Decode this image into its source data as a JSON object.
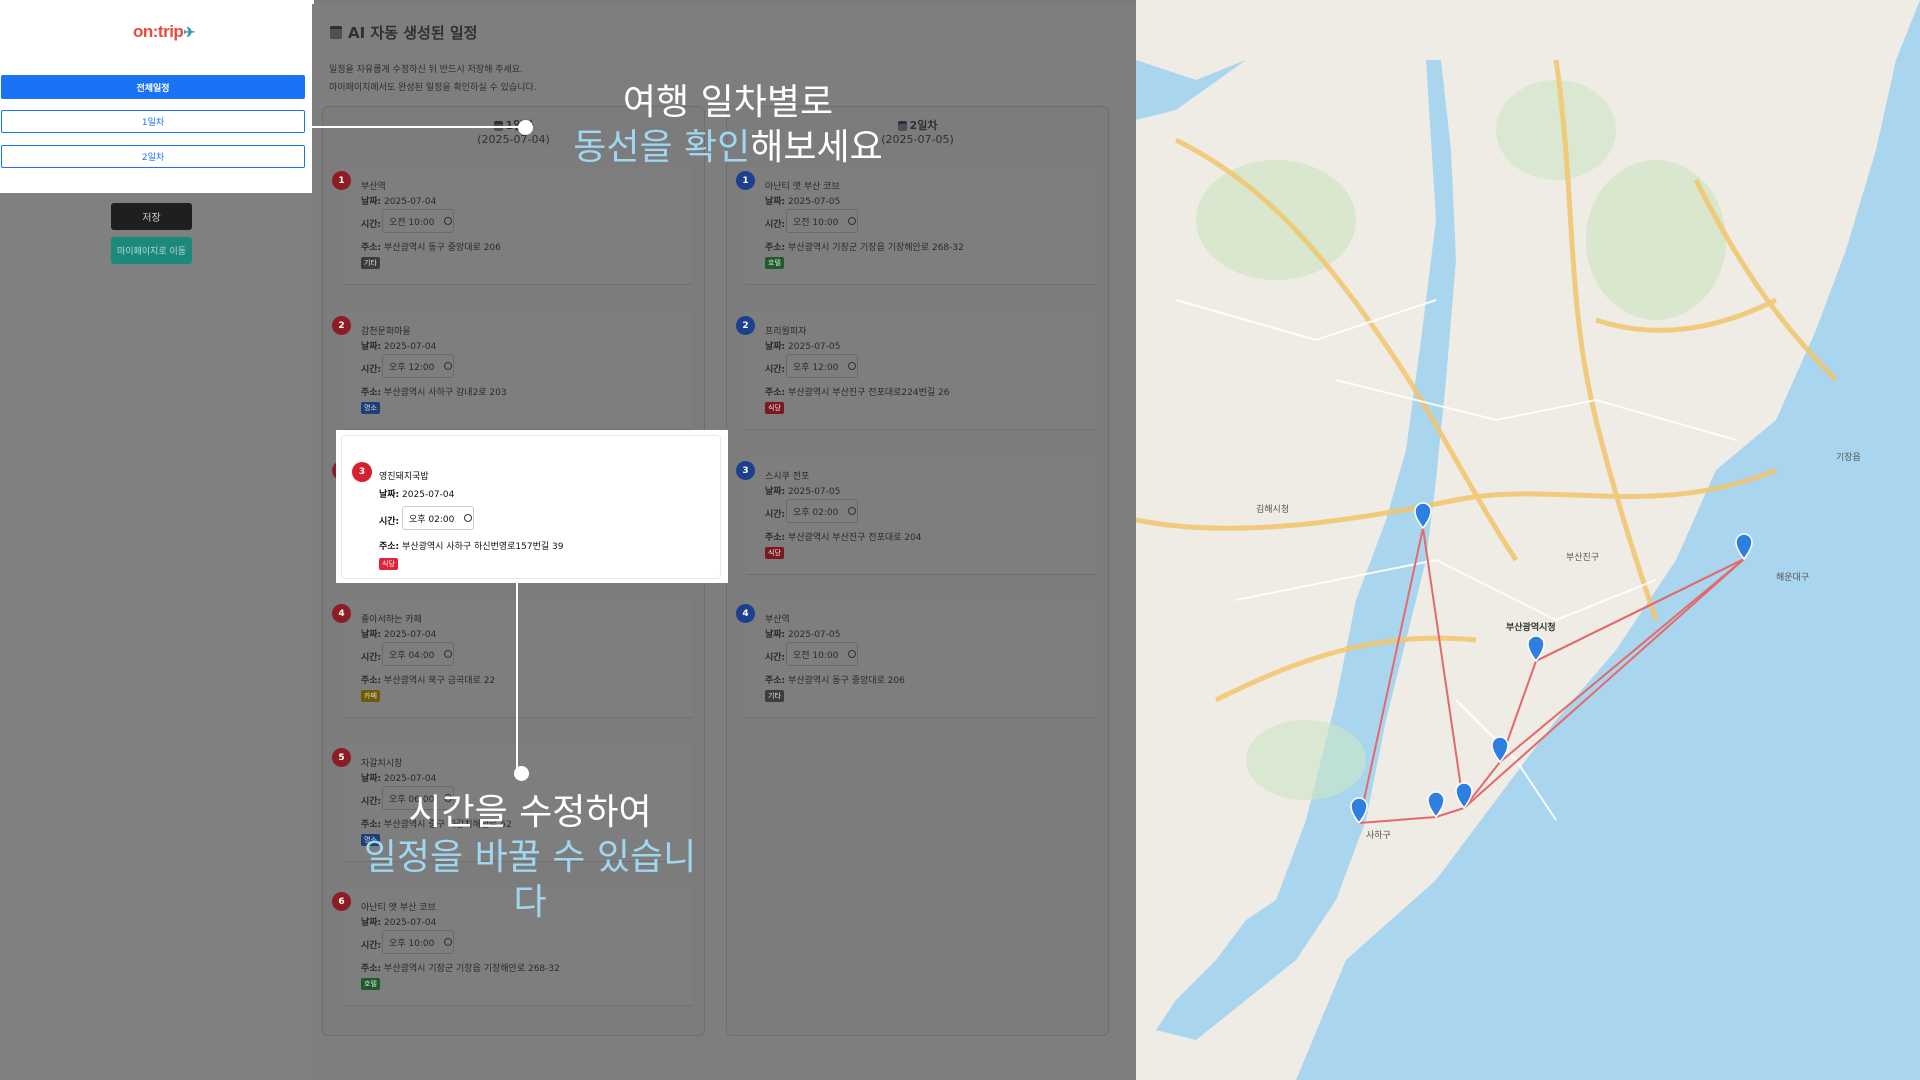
{
  "sidebar": {
    "logo_main": "on:trip",
    "buttons": {
      "all": "전체일정",
      "day1": "1일차",
      "day2": "2일차",
      "save": "저장",
      "mypage": "마이페이지로 이동"
    }
  },
  "main": {
    "title": "AI 자동 생성된 일정",
    "desc1": "일정을 자유롭게 수정하신 뒤 반드시 저장해 주세요.",
    "desc2": "마이페이지에서도 완성된 일정을 확인하실 수 있습니다.",
    "labels": {
      "date": "날짜:",
      "time": "시간:",
      "addr": "주소:"
    },
    "days": [
      {
        "title": "1일차",
        "date": "(2025-07-04)",
        "items": [
          {
            "num": "1",
            "name": "부산역",
            "date": "2025-07-04",
            "time": "오전 10:00",
            "addr": "부산광역시 동구 중앙대로 206",
            "tag": "기타"
          },
          {
            "num": "2",
            "name": "감천문화마을",
            "date": "2025-07-04",
            "time": "오후 12:00",
            "addr": "부산광역시 사하구 감내2로 203",
            "tag": "명소"
          },
          {
            "num": "3",
            "name": "영진돼지국밥",
            "date": "2025-07-04",
            "time": "오후 02:00",
            "addr": "부산광역시 사하구 하신번영로157번길 39",
            "tag": "식당"
          },
          {
            "num": "4",
            "name": "좋아서하는 카페",
            "date": "2025-07-04",
            "time": "오후 04:00",
            "addr": "부산광역시 북구 금곡대로 22",
            "tag": "카페"
          },
          {
            "num": "5",
            "name": "자갈치시장",
            "date": "2025-07-04",
            "time": "오후 06:00",
            "addr": "부산광역시 중구 자갈치해안로 52",
            "tag": "명소"
          },
          {
            "num": "6",
            "name": "아난티 앳 부산 코브",
            "date": "2025-07-04",
            "time": "오후 10:00",
            "addr": "부산광역시 기장군 기장읍 기장해안로 268-32",
            "tag": "호텔"
          }
        ]
      },
      {
        "title": "2일차",
        "date": "(2025-07-05)",
        "items": [
          {
            "num": "1",
            "name": "아난티 앳 부산 코브",
            "date": "2025-07-05",
            "time": "오전 10:00",
            "addr": "부산광역시 기장군 기장읍 기장해안로 268-32",
            "tag": "호텔"
          },
          {
            "num": "2",
            "name": "프리월피자",
            "date": "2025-07-05",
            "time": "오후 12:00",
            "addr": "부산광역시 부산진구 전포대로224번길 26",
            "tag": "식당"
          },
          {
            "num": "3",
            "name": "스시쿠 전포",
            "date": "2025-07-05",
            "time": "오후 02:00",
            "addr": "부산광역시 부산진구 전포대로 204",
            "tag": "식당"
          },
          {
            "num": "4",
            "name": "부산역",
            "date": "2025-07-05",
            "time": "오전 10:00",
            "addr": "부산광역시 동구 중앙대로 206",
            "tag": "기타"
          }
        ]
      }
    ]
  },
  "map": {
    "labels": [
      "부산광역시청",
      "김해시청",
      "해운대구",
      "기장읍",
      "사하구",
      "부산진구"
    ],
    "route_color": "#e36a6a",
    "pin_color": "#2f7fe0"
  },
  "callouts": {
    "c1_line1": "여행 일차별로",
    "c1_hl": "동선을 확인",
    "c1_rest": "해보세요",
    "c2_line1": "시간을 수정하여",
    "c2_hl": "일정을 바꿀 수 있습니다"
  }
}
